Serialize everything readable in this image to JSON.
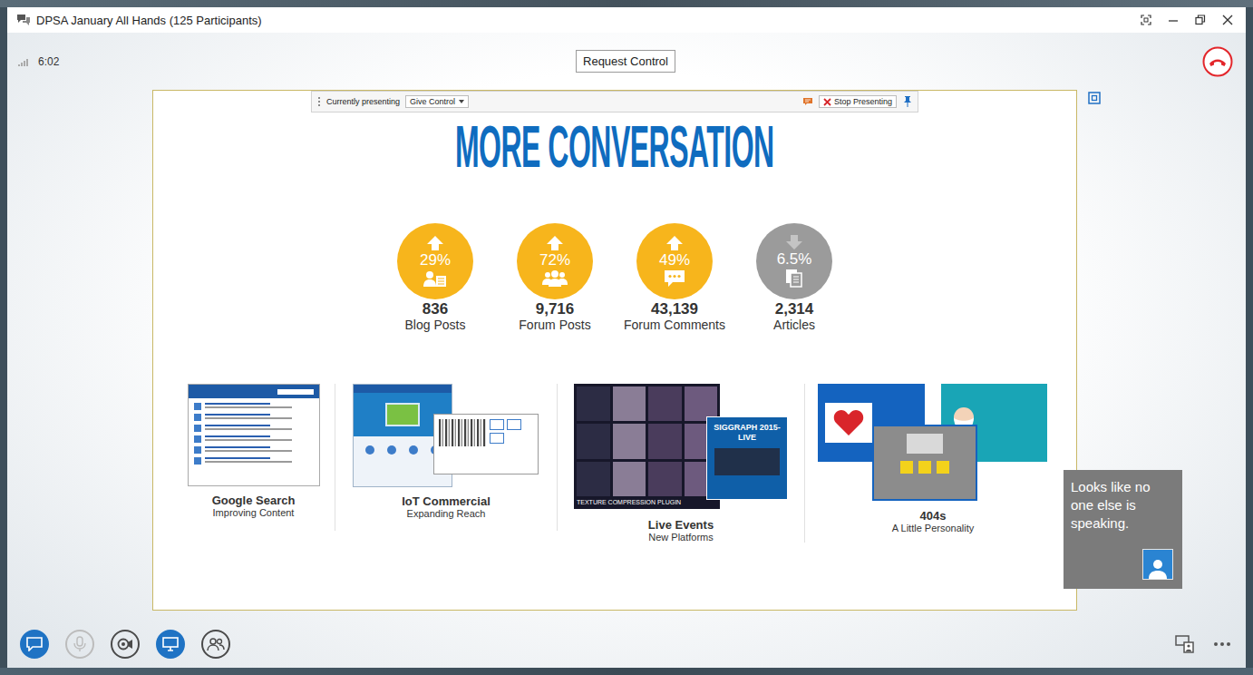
{
  "window": {
    "title": "DPSA January All Hands (125 Participants)"
  },
  "call": {
    "duration": "6:02",
    "request_control": "Request Control"
  },
  "presenter_bar": {
    "label": "Currently presenting",
    "give_control": "Give Control",
    "stop": "Stop Presenting"
  },
  "slide": {
    "title": "MORE CONVERSATION",
    "stats": [
      {
        "kind": "blog",
        "direction": "up",
        "percent": "29%",
        "value": "836",
        "label": "Blog Posts",
        "color": "#f7b51c"
      },
      {
        "kind": "forum",
        "direction": "up",
        "percent": "72%",
        "value": "9,716",
        "label": "Forum Posts",
        "color": "#f7b51c"
      },
      {
        "kind": "comment",
        "direction": "up",
        "percent": "49%",
        "value": "43,139",
        "label": "Forum Comments",
        "color": "#f7b51c"
      },
      {
        "kind": "article",
        "direction": "down",
        "percent": "6.5%",
        "value": "2,314",
        "label": "Articles",
        "color": "#9b9b9b"
      }
    ],
    "features": [
      {
        "kind": "search",
        "title": "Google Search",
        "subtitle": "Improving Content",
        "thumb_texts": []
      },
      {
        "kind": "iot",
        "title": "IoT Commercial",
        "subtitle": "Expanding Reach",
        "thumb_texts": []
      },
      {
        "kind": "events",
        "title": "Live Events",
        "subtitle": "New Platforms",
        "thumb_texts": [
          "SIGGRAPH 2015-LIVE",
          "TEXTURE COMPRESSION PLUGIN"
        ]
      },
      {
        "kind": "errors",
        "title": "404s",
        "subtitle": "A Little Personality",
        "thumb_texts": []
      }
    ]
  },
  "tooltip": {
    "text": "Looks like no one else is speaking."
  },
  "controls": [
    {
      "kind": "chat",
      "selected": true,
      "disabled": false
    },
    {
      "kind": "mic",
      "selected": false,
      "disabled": true
    },
    {
      "kind": "video",
      "selected": false,
      "disabled": false
    },
    {
      "kind": "present",
      "selected": true,
      "disabled": false
    },
    {
      "kind": "participants",
      "selected": false,
      "disabled": false
    }
  ]
}
